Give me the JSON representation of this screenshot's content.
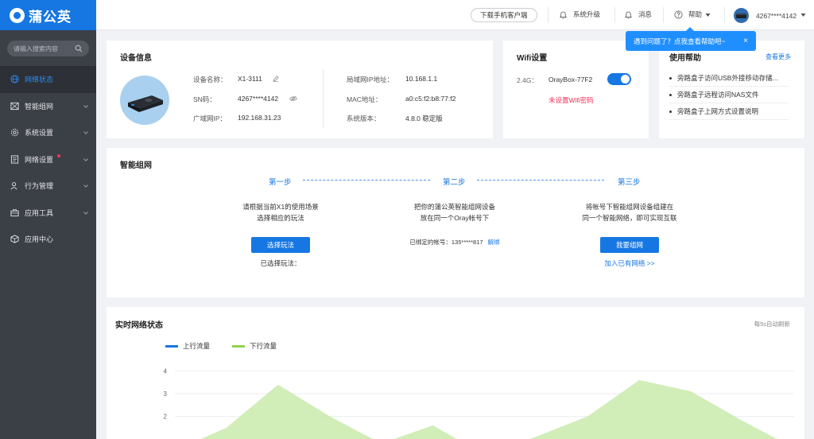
{
  "app": {
    "logo_text": "蒲公英"
  },
  "sidebar": {
    "search_placeholder": "请输入搜索内容",
    "items": [
      {
        "label": "网络状态",
        "icon": "globe-icon",
        "active": true
      },
      {
        "label": "智能组网",
        "icon": "network-icon"
      },
      {
        "label": "系统设置",
        "icon": "gear-icon"
      },
      {
        "label": "网络设置",
        "icon": "document-icon",
        "badge": true
      },
      {
        "label": "行为管理",
        "icon": "user-check-icon"
      },
      {
        "label": "应用工具",
        "icon": "toolbox-icon"
      },
      {
        "label": "应用中心",
        "icon": "cube-icon"
      }
    ]
  },
  "topbar": {
    "download_label": "下载手机客户端",
    "upgrade_label": "系统升级",
    "messages_label": "消息",
    "help_label": "帮助",
    "user_label": "4267****4142"
  },
  "tooltip": {
    "text": "遇到问题了？点我查看帮助吧~",
    "close": "×"
  },
  "device_info": {
    "title": "设备信息",
    "name_label": "设备名称：",
    "name_value": "X1-3111",
    "sn_label": "SN码：",
    "sn_value": "4267****4142",
    "wan_label": "广域网IP：",
    "wan_value": "192.168.31.23",
    "lan_label": "局域网IP地址：",
    "lan_value": "10.168.1.1",
    "mac_label": "MAC地址：",
    "mac_value": "a0:c5:f2:b8:77:f2",
    "version_label": "系统版本：",
    "version_value": "4.8.0 稳定版"
  },
  "wifi": {
    "title": "Wifi设置",
    "band_label": "2.4G：",
    "ssid": "OrayBox-77F2",
    "enabled": true,
    "warning": "未设置Wifi密码",
    "warning_color": "#f5315a"
  },
  "help": {
    "title": "使用帮助",
    "more_label": "查看更多",
    "items": [
      "旁路盒子访问USB外接移动存储...",
      "旁路盒子远程访问NAS文件",
      "旁路盒子上网方式设置说明"
    ]
  },
  "smart_network": {
    "title": "智能组网",
    "step1": {
      "label": "第一步",
      "line1": "请根据当前X1的使用场景",
      "line2": "选择相应的玩法",
      "button": "选择玩法",
      "selected_label": "已选择玩法："
    },
    "step2": {
      "label": "第二步",
      "line1": "把你的蒲公英智能组网设备",
      "line2": "放在同一个Oray帐号下",
      "bound_label": "已绑定的帐号：135*****817",
      "unbind_label": "解绑"
    },
    "step3": {
      "label": "第三步",
      "line1": "将帐号下智能组网设备组建在",
      "line2": "同一个智能网络，即可实现互联",
      "button": "我要组网",
      "join_link": "加入已有网络 >>"
    }
  },
  "realtime": {
    "title": "实时网络状态",
    "refresh_note": "每5s自动刷新",
    "legend_up": "上行流量",
    "legend_down": "下行流量",
    "up_color": "#1677e3",
    "down_color": "#8fd14f",
    "y_ticks": [
      "4",
      "3",
      "2"
    ]
  },
  "chart_data": {
    "type": "area",
    "series": [
      {
        "name": "上行流量",
        "values": []
      },
      {
        "name": "下行流量",
        "values": [
          0.5,
          1.5,
          3.4,
          2.0,
          0.8,
          1.6,
          0.3,
          1.1,
          2.0,
          3.6,
          3.1,
          1.8,
          0.6
        ]
      }
    ],
    "yticks": [
      2,
      3,
      4
    ],
    "legend_position": "top-left",
    "grid": true
  }
}
